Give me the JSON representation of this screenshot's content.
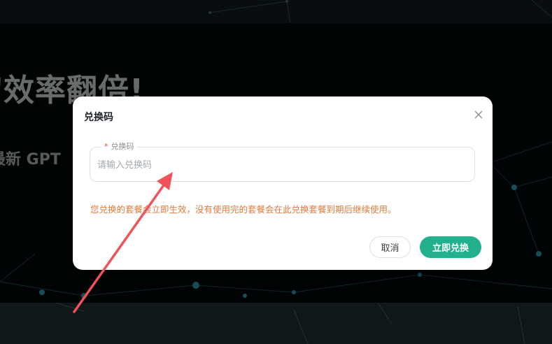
{
  "background": {
    "hero_title": "刀效率翻倍!",
    "hero_subtitle": "最新 GPT"
  },
  "dialog": {
    "title": "兑换码",
    "close_icon": "close-icon",
    "field": {
      "required_mark": "*",
      "label": "兑换码",
      "placeholder": "请输入兑换码",
      "value": ""
    },
    "notice": "您兑换的套餐会立即生效，没有使用完的套餐会在此兑换套餐到期后继续使用。",
    "cancel_label": "取消",
    "confirm_label": "立即兑换"
  },
  "colors": {
    "accent": "#23b08c",
    "notice": "#e07a3b",
    "required": "#e8483f",
    "annotation_arrow": "#f0525a"
  }
}
